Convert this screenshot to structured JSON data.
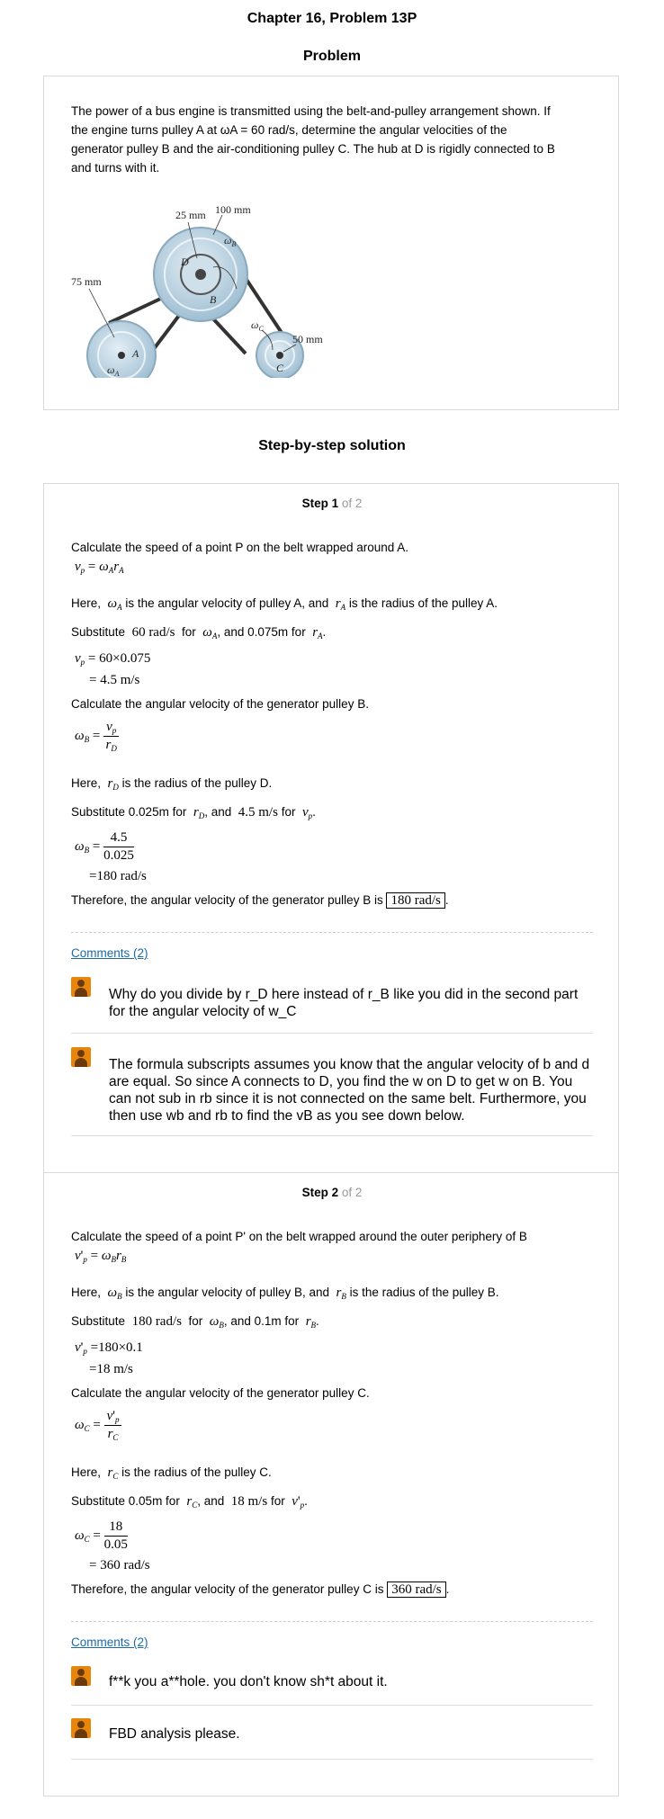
{
  "header": {
    "chapter_title": "Chapter 16, Problem 13P",
    "problem_heading": "Problem"
  },
  "problem": {
    "text_lines": [
      "The power of a bus engine is transmitted using the belt-and-pulley arrangement shown. If",
      "the engine turns pulley A at ωA = 60 rad/s, determine the angular velocities of the",
      "generator pulley B and the air-conditioning pulley C. The hub at D is rigidly connected to B",
      "and turns with it."
    ],
    "figure_labels": {
      "r100": "100 mm",
      "r25": "25 mm",
      "r75": "75 mm",
      "r50": "50 mm",
      "omega_b": "ω",
      "omega_b_sub": "B",
      "omega_c": "ω",
      "omega_c_sub": "C",
      "omega_a": "ω",
      "omega_a_sub": "A",
      "a": "A",
      "b": "B",
      "c": "C",
      "d": "D"
    }
  },
  "solution_heading": "Step-by-step solution",
  "step1": {
    "step_label": "Step 1",
    "of_label": "of 2",
    "l1": "Calculate the speed of a point P on the belt wrapped around A.",
    "here1_a": "Here,",
    "here1_b": "is the angular velocity of pulley A, and",
    "here1_c": "is the radius of the pulley A.",
    "sub1_a": "Substitute",
    "sub1_v": "60 rad/s",
    "sub1_b": "for",
    "sub1_c": ", and 0.075m for",
    "eq1_line1": "= 60×0.075",
    "eq1_line2": "= 4.5 m/s",
    "l2": "Calculate the angular velocity of the generator pulley B.",
    "here2_a": "Here,",
    "here2_b": "is the radius of the pulley D.",
    "sub2_a": "Substitute 0.025m for",
    "sub2_b": ", and",
    "sub2_v": "4.5 m/s",
    "sub2_c": "for",
    "eq3_num": "4.5",
    "eq3_den": "0.025",
    "eq3_res": "=180 rad/s",
    "conclusion": "Therefore, the angular velocity of the generator pulley B is",
    "answer": "180 rad/s",
    "comments_link": "Comments (2)",
    "comments": [
      "Why do you divide by r_D here instead of r_B like you did in the second part for the angular velocity of w_C",
      "The formula subscripts assumes you know that the angular velocity of b and d are equal. So since A connects to D, you find the w on D to get w on B. You can not sub in rb since it is not connected on the same belt. Furthermore, you then use wb and rb to find the vB as you see down below."
    ]
  },
  "step2": {
    "step_label": "Step 2",
    "of_label": "of 2",
    "l1": "Calculate the speed of a point P' on the belt wrapped around the outer periphery of B",
    "here1_a": "Here,",
    "here1_b": "is the angular velocity of pulley B, and",
    "here1_c": "is the radius of the pulley B.",
    "sub1_a": "Substitute",
    "sub1_v": "180 rad/s",
    "sub1_b": "for",
    "sub1_c": ", and 0.1m for",
    "eq1_line1": "=180×0.1",
    "eq1_line2": "=18 m/s",
    "l2": "Calculate the angular velocity of the generator pulley C.",
    "here2_a": "Here,",
    "here2_b": "is the radius of the pulley C.",
    "sub2_a": "Substitute 0.05m for",
    "sub2_b": ", and",
    "sub2_v": "18 m/s",
    "sub2_c": "for",
    "eq3_num": "18",
    "eq3_den": "0.05",
    "eq3_res": "= 360 rad/s",
    "conclusion": "Therefore, the angular velocity of the generator pulley C is",
    "answer": "360 rad/s",
    "comments_link": "Comments (2)",
    "comments": [
      "f**k you a**hole. you don't know sh*t about it.",
      "FBD analysis please."
    ]
  },
  "colors": {
    "link": "#1a6aa6",
    "avatar": "#e8860c",
    "border": "#d9d9d9",
    "pulley": "#b9d0df"
  }
}
